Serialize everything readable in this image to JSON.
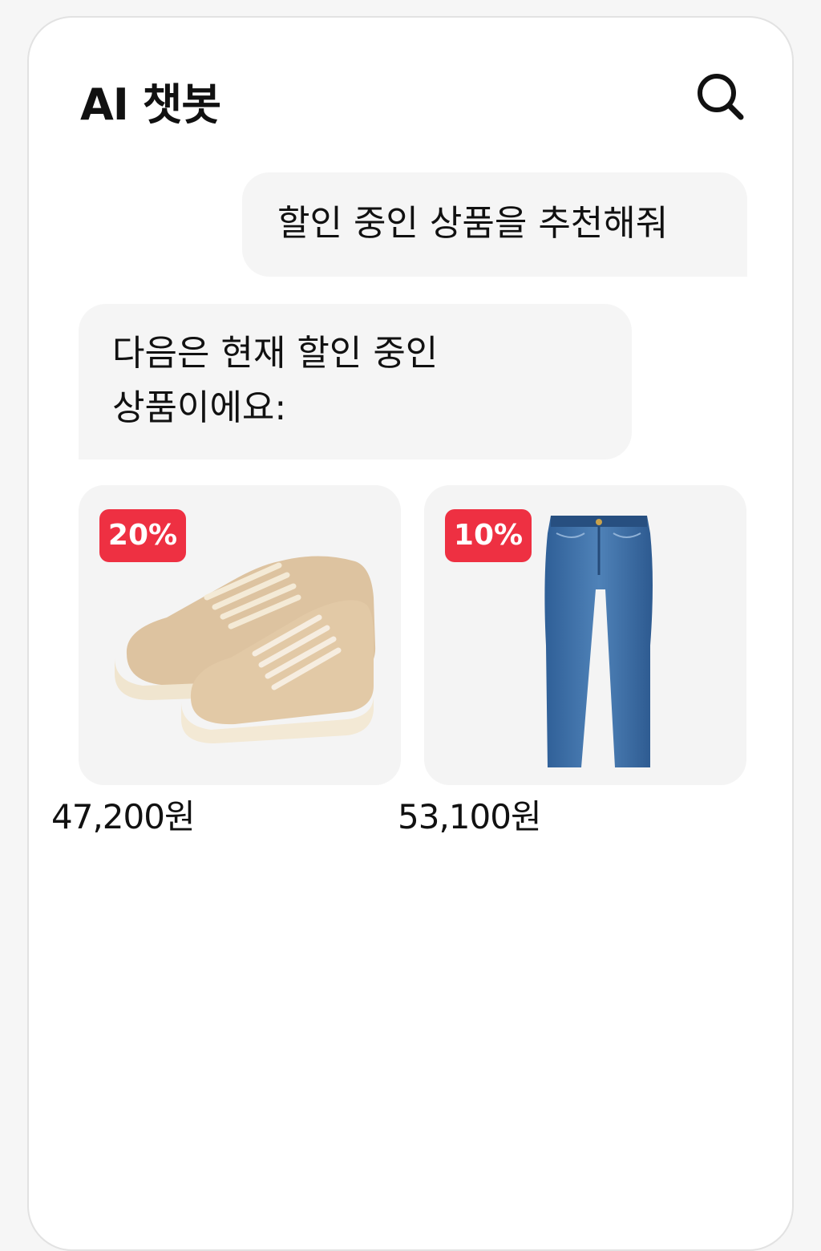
{
  "header": {
    "title": "AI 챗봇",
    "search_icon": "search-icon"
  },
  "messages": {
    "user": "할인 중인 상품을 추천해줘",
    "bot": "다음은 현재 할인 중인 상품이에요:"
  },
  "products": [
    {
      "name_icon": "sneakers-image",
      "discount": "20%",
      "price": "47,200원"
    },
    {
      "name_icon": "jeans-image",
      "discount": "10%",
      "price": "53,100원"
    }
  ],
  "colors": {
    "accent": "#ee3042",
    "bubble": "#f5f5f5",
    "card": "#f4f4f4"
  }
}
